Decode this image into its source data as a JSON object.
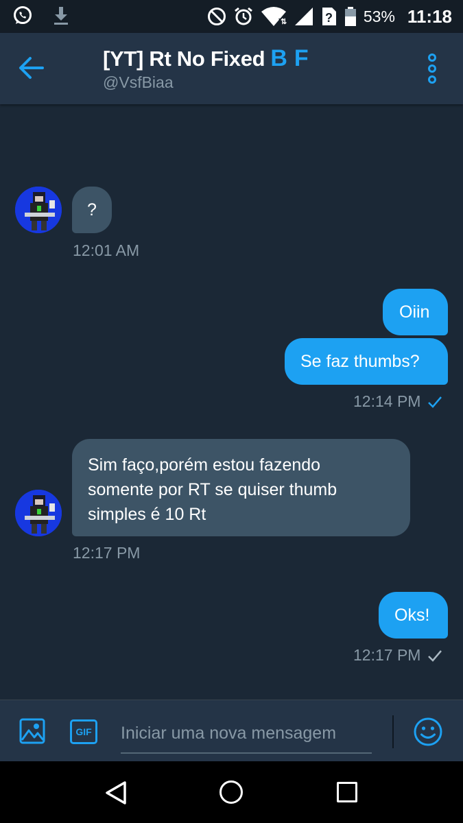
{
  "status_bar": {
    "battery": "53%",
    "time": "11:18",
    "icons": [
      "whatsapp-icon",
      "download-icon",
      "do-not-disturb-icon",
      "alarm-icon",
      "wifi-icon",
      "signal-icon",
      "unknown-sim-icon",
      "battery-icon"
    ]
  },
  "header": {
    "title": "[YT] Rt No Fixed",
    "title_emoji": "BF",
    "handle": "@VsfBiaa"
  },
  "messages": [
    {
      "direction": "incoming",
      "lines": [
        "?"
      ],
      "timestamp": "12:01 AM"
    },
    {
      "direction": "outgoing",
      "lines": [
        "Oiin"
      ]
    },
    {
      "direction": "outgoing",
      "lines": [
        "Se faz thumbs?"
      ],
      "timestamp": "12:14 PM",
      "status": "read"
    },
    {
      "direction": "incoming",
      "lines": [
        "Sim faço,porém estou fazendo",
        "somente por RT se quiser thumb",
        "simples é 10 Rt"
      ],
      "timestamp": "12:17 PM"
    },
    {
      "direction": "outgoing",
      "lines": [
        "Oks!"
      ],
      "timestamp": "12:17 PM",
      "status": "sent"
    }
  ],
  "composer": {
    "placeholder": "Iniciar uma nova mensagem",
    "gif_label": "GIF"
  },
  "colors": {
    "accent": "#1da1f2",
    "background": "#1b2836",
    "header": "#243447",
    "incoming_bubble": "#3d5466",
    "muted_text": "#8899a6"
  }
}
